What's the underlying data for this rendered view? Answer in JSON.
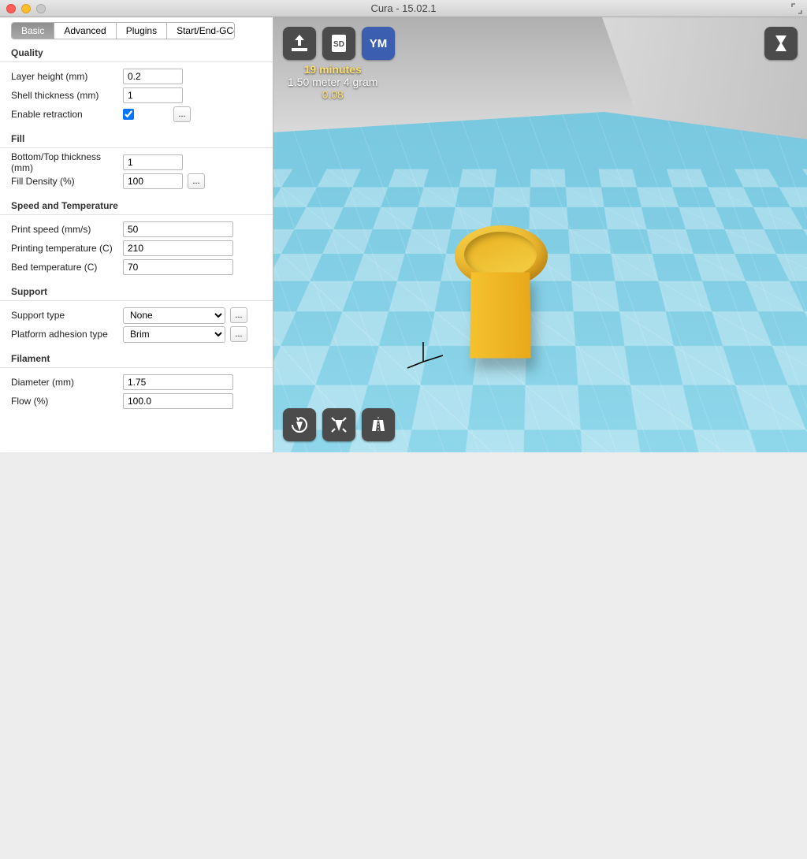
{
  "window": {
    "title": "Cura - 15.02.1"
  },
  "tabs": [
    "Basic",
    "Advanced",
    "Plugins",
    "Start/End-GCode"
  ],
  "active_tab": 0,
  "sections": {
    "quality": {
      "head": "Quality",
      "layer_height_lbl": "Layer height (mm)",
      "layer_height": "0.2",
      "shell_lbl": "Shell thickness (mm)",
      "shell": "1",
      "retract_lbl": "Enable retraction",
      "retract": true
    },
    "fill": {
      "head": "Fill",
      "bt_lbl": "Bottom/Top thickness (mm)",
      "bt": "1",
      "density_lbl": "Fill Density (%)",
      "density": "100"
    },
    "speed": {
      "head": "Speed and Temperature",
      "pspeed_lbl": "Print speed (mm/s)",
      "pspeed": "50",
      "ptemp_lbl": "Printing temperature (C)",
      "ptemp": "210",
      "btemp_lbl": "Bed temperature (C)",
      "btemp": "70"
    },
    "support": {
      "head": "Support",
      "type_lbl": "Support type",
      "type": "None",
      "adh_lbl": "Platform adhesion type",
      "adh": "Brim"
    },
    "filament": {
      "head": "Filament",
      "dia_lbl": "Diameter (mm)",
      "dia": "1.75",
      "flow_lbl": "Flow (%)",
      "flow": "100.0"
    }
  },
  "ellipsis": "...",
  "printinfo": {
    "time": "19 minutes",
    "usage": "1.50 meter 4 gram",
    "cost": "0.08"
  },
  "icons": {
    "load": "load-model",
    "sd": "SD",
    "ym": "YM"
  }
}
